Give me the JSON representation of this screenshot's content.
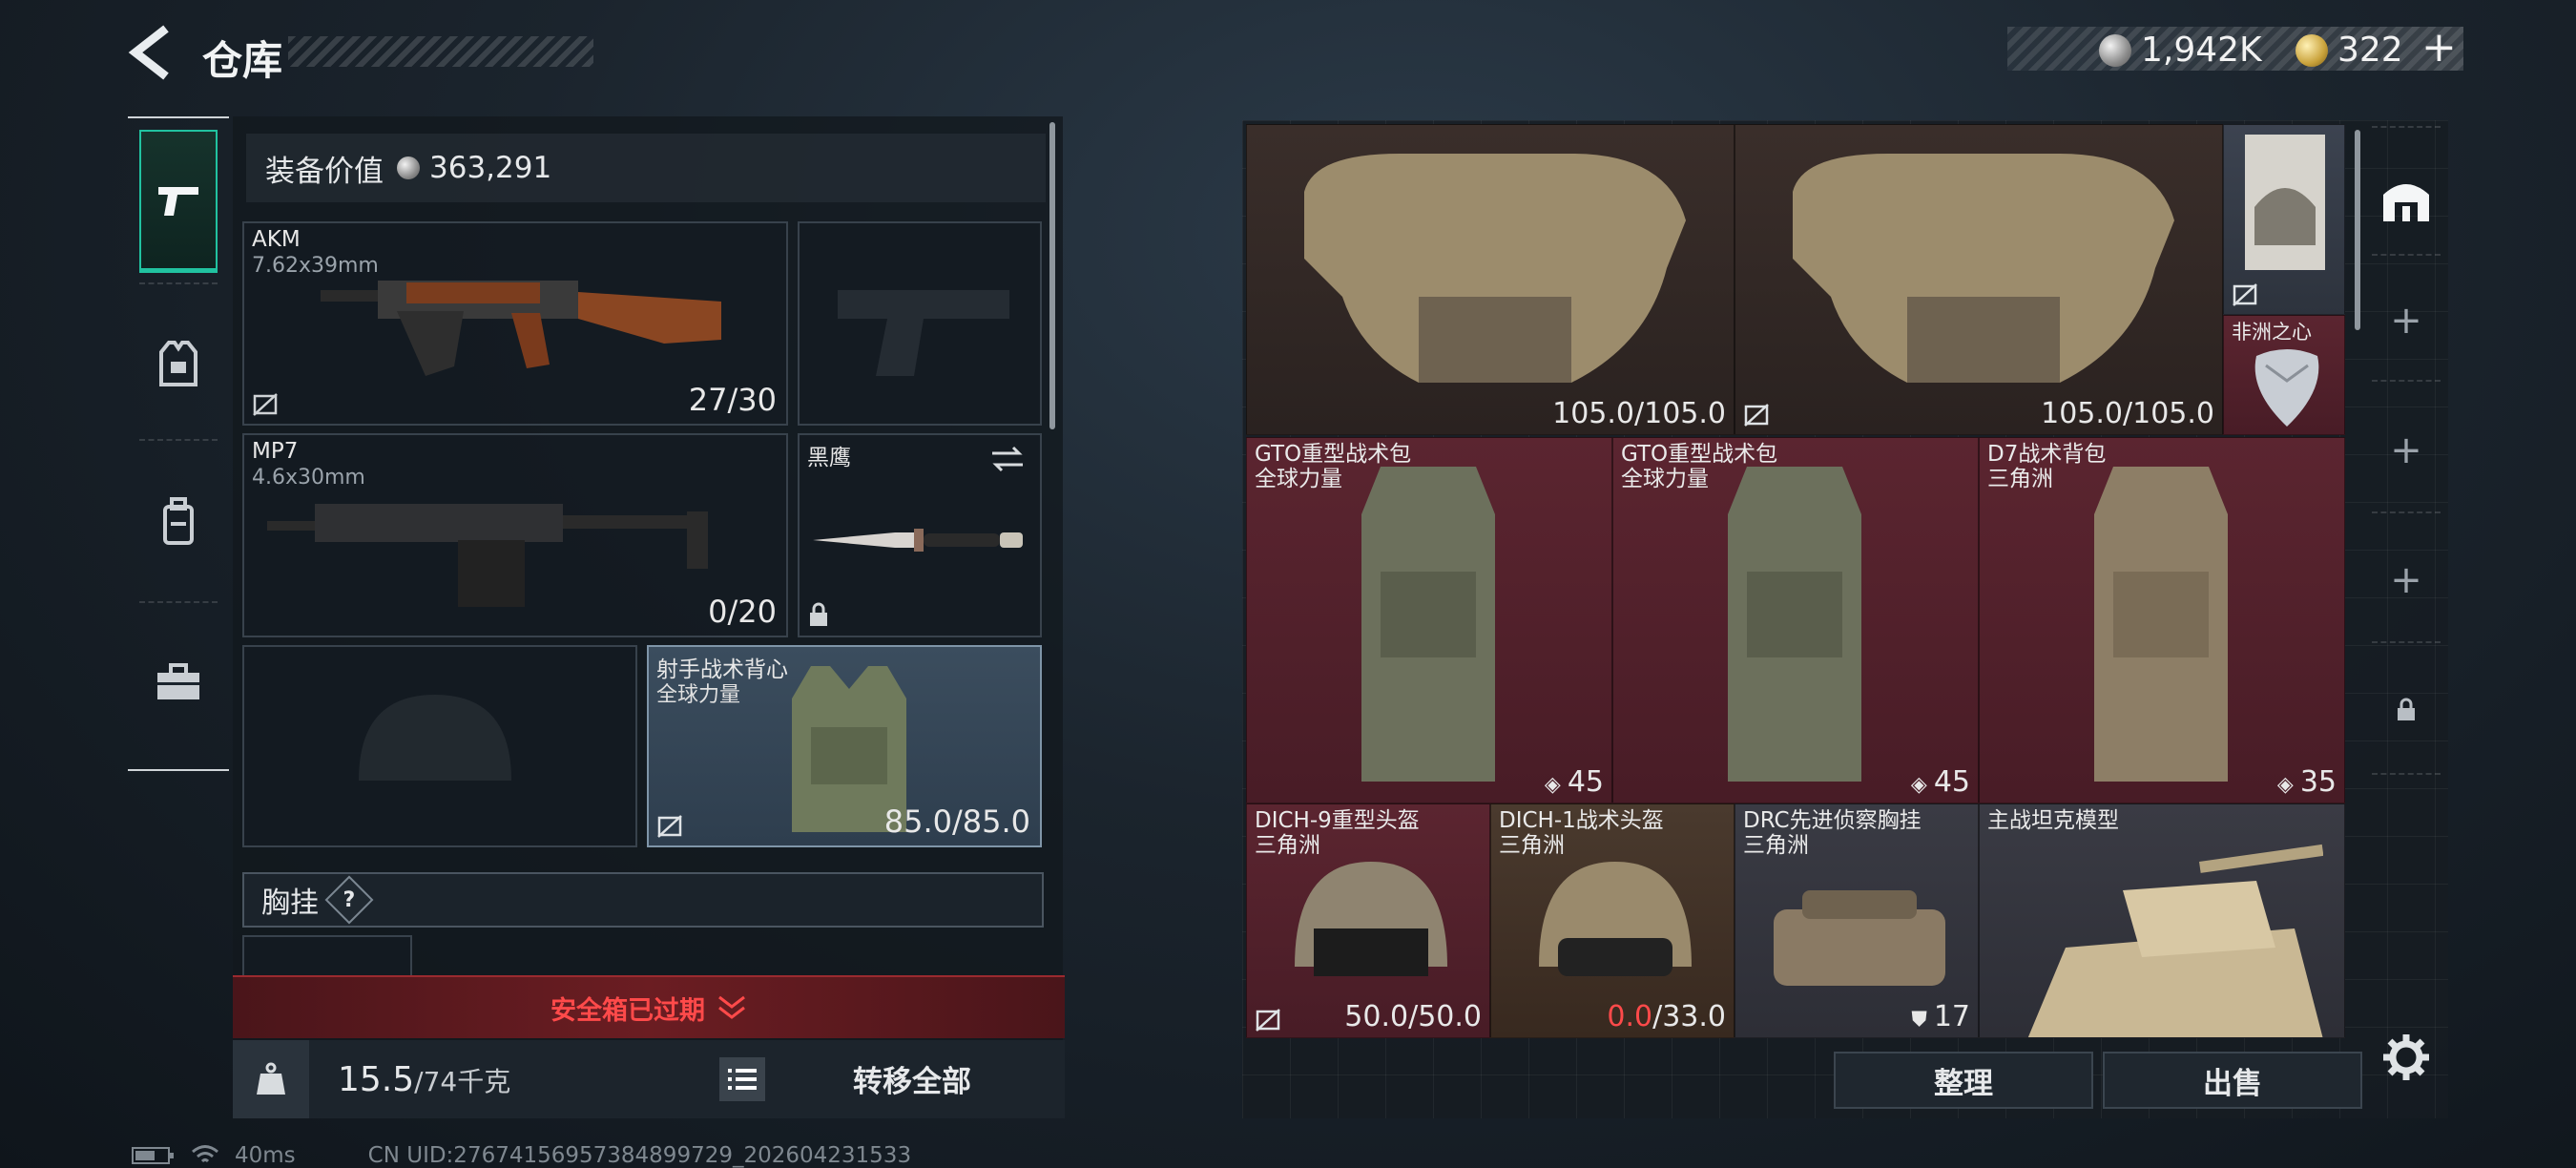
{
  "header": {
    "title": "仓库",
    "currency": [
      {
        "icon": "silver-coin-icon",
        "value": "1,942K"
      },
      {
        "icon": "gold-coin-icon",
        "value": "322"
      }
    ],
    "add_label": "+"
  },
  "left_panel": {
    "equipment_value_label": "装备价值",
    "equipment_value": "363,291",
    "slots": {
      "primary": {
        "name": "AKM",
        "ammo": "7.62x39mm",
        "count": "27/30"
      },
      "secondary": {
        "name": "MP7",
        "ammo": "4.6x30mm",
        "count": "0/20"
      },
      "melee": {
        "name": "黑鹰"
      },
      "vest": {
        "name": "射手战术背心",
        "sub": "全球力量",
        "count": "85.0/85.0"
      }
    },
    "chest_rig_label": "胸挂",
    "chest_rig_help": "?",
    "safebox_warning": "安全箱已过期",
    "weight": "15.5",
    "weight_capacity": "/74千克",
    "transfer_all_label": "转移全部"
  },
  "storage": {
    "items": [
      {
        "name": "",
        "sub": "",
        "count": "105.0/105.0"
      },
      {
        "name": "",
        "sub": "",
        "count": "105.0/105.0"
      },
      {
        "name": "非洲之心",
        "sub": "",
        "count": ""
      },
      {
        "name": "GTO重型战术包",
        "sub": "全球力量",
        "count": "45"
      },
      {
        "name": "GTO重型战术包",
        "sub": "全球力量",
        "count": "45"
      },
      {
        "name": "D7战术背包",
        "sub": "三角洲",
        "count": "35"
      },
      {
        "name": "DICH-9重型头盔",
        "sub": "三角洲",
        "count": "50.0/50.0"
      },
      {
        "name": "DICH-1战术头盔",
        "sub": "三角洲",
        "count_current": "0.0",
        "count_total": "/33.0"
      },
      {
        "name": "DRC先进侦察胸挂",
        "sub": "三角洲",
        "count": "17"
      },
      {
        "name": "主战坦克模型",
        "sub": "",
        "count": ""
      }
    ],
    "sort_label": "整理",
    "sell_label": "出售"
  },
  "status_bar": {
    "ping": "40ms",
    "uid": "CN UID:276741569573848997​29_202604231533"
  },
  "colors": {
    "accent": "#21c2a0",
    "warning": "#ff4a4a"
  }
}
